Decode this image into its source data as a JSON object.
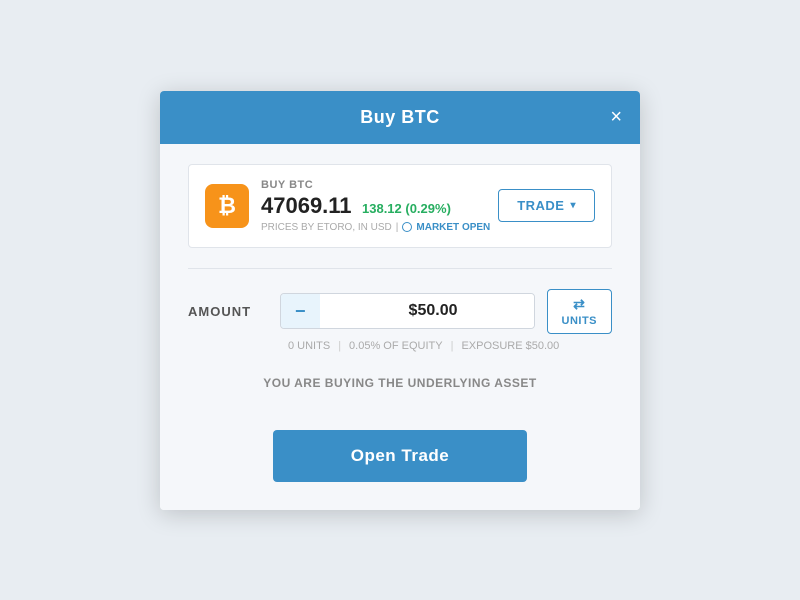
{
  "modal": {
    "title": "Buy BTC",
    "close_label": "×"
  },
  "asset": {
    "label": "BUY BTC",
    "icon_symbol": "₿",
    "price": "47069.11",
    "change": "138.12 (0.29%)",
    "meta_price_source": "PRICES BY ETORO, IN USD",
    "market_status": "MARKET OPEN"
  },
  "trade_button": {
    "label": "TRADE",
    "chevron": "▾"
  },
  "amount": {
    "label": "AMOUNT",
    "minus_label": "−",
    "value": "$50.00",
    "plus_label": "+",
    "units_icon": "⇄",
    "units_label": "UNITS"
  },
  "amount_info": {
    "units": "0 UNITS",
    "separator1": "|",
    "equity": "0.05% OF EQUITY",
    "separator2": "|",
    "exposure": "EXPOSURE $50.00"
  },
  "message": "YOU ARE BUYING THE UNDERLYING ASSET",
  "open_trade": {
    "label": "Open Trade"
  }
}
